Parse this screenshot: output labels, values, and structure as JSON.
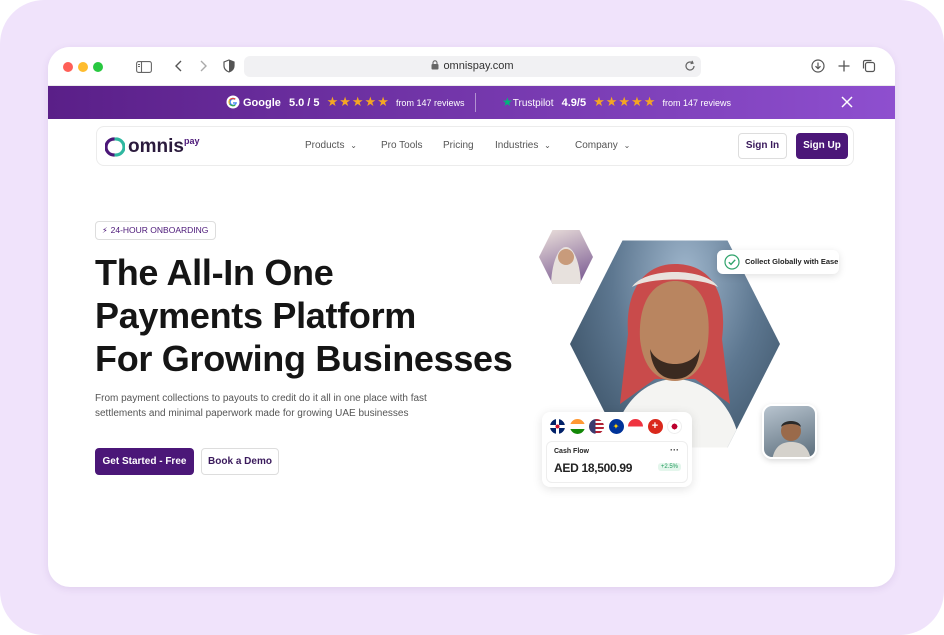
{
  "browser": {
    "url": "omnispay.com"
  },
  "banner": {
    "google_label": "Google",
    "google_rating": "5.0 / 5",
    "google_reviews": "from 147 reviews",
    "trustpilot_label": "Trustpilot",
    "trustpilot_rating": "4.9/5",
    "trustpilot_reviews": "from 147 reviews",
    "star_count": 5
  },
  "nav": {
    "logo_text": "omnis",
    "logo_sup": "pay",
    "items": [
      "Products",
      "Pro Tools",
      "Pricing",
      "Industries",
      "Company"
    ],
    "sign_in": "Sign In",
    "sign_up": "Sign Up"
  },
  "hero": {
    "badge": "24-HOUR ONBOARDING",
    "title_line1": "The All-In One",
    "title_line2": "Payments Platform",
    "title_line3": "For Growing Businesses",
    "subtitle_line1": "From payment collections to payouts to credit do it all in one place with fast",
    "subtitle_line2": "settlements and minimal paperwork made for growing UAE businesses",
    "cta_primary": "Get Started - Free",
    "cta_secondary": "Book a Demo"
  },
  "collect_card": {
    "label": "Collect Globally with Ease"
  },
  "cashflow": {
    "label": "Cash Flow",
    "menu": "···",
    "amount": "AED 18,500.99",
    "change": "+2.5%",
    "flags": [
      "uk",
      "india",
      "usa",
      "eu",
      "singapore",
      "switzerland",
      "japan"
    ]
  },
  "colors": {
    "brand_purple": "#4b1778",
    "banner_start": "#5a1f88",
    "banner_end": "#8e4fcf",
    "star": "#f5a623",
    "positive": "#1f9a5a"
  }
}
